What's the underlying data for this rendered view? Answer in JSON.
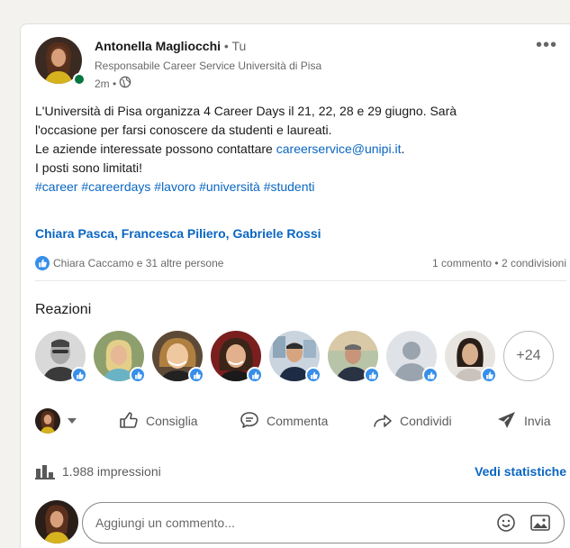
{
  "post": {
    "author_name": "Antonella Magliocchi",
    "author_degree": "• Tu",
    "author_title": "Responsabile Career Service Università di Pisa",
    "time": "2m •",
    "body_line1": "L'Università di Pisa organizza 4 Career Days il 21, 22, 28 e 29 giugno. Sarà",
    "body_line2": "l'occasione per farsi conoscere da studenti e laureati.",
    "body_line3_prefix": "Le aziende interessate possono contattare ",
    "body_link": "careerservice@unipi.it",
    "body_line3_suffix": ".",
    "body_line4": "I posti sono limitati!",
    "hashtags": "#career #careerdays #lavoro #università #studenti",
    "mentions": "Chiara Pasca, Francesca Piliero, Gabriele Rossi"
  },
  "social": {
    "likes_text": "Chiara Caccamo e 31 altre persone",
    "counts_text": "1 commento • 2 condivisioni"
  },
  "reactions": {
    "title": "Reazioni",
    "more_count": "+24"
  },
  "actions": {
    "like": "Consiglia",
    "comment": "Commenta",
    "share": "Condividi",
    "send": "Invia"
  },
  "impressions": {
    "text": "1.988 impressioni",
    "stats_link": "Vedi statistiche"
  },
  "comment": {
    "placeholder": "Aggiungi un commento..."
  },
  "colors": {
    "link": "#0a66c2",
    "like_badge": "#378fe9",
    "presence": "#057642"
  }
}
